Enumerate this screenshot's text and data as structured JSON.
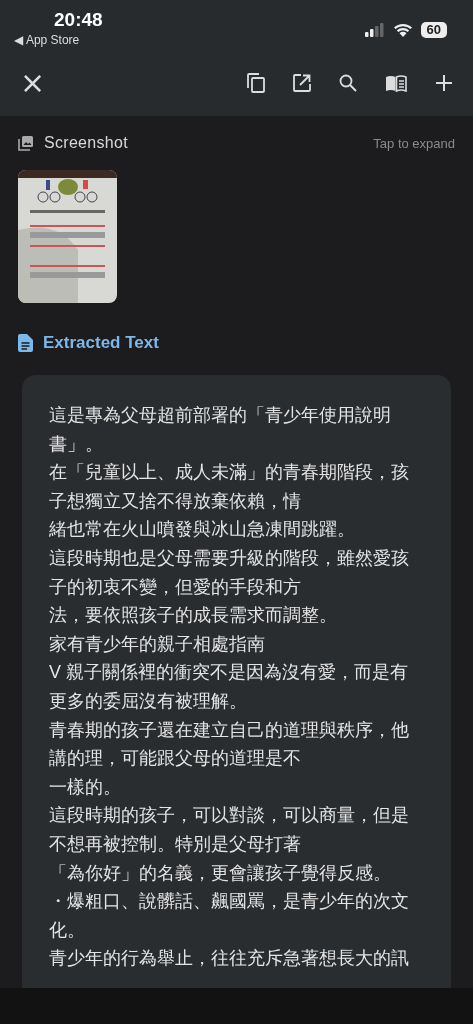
{
  "status_bar": {
    "time": "20:48",
    "back_label": "◀ App Store",
    "battery": "60"
  },
  "toolbar": {
    "close": "×"
  },
  "screenshot_section": {
    "title": "Screenshot",
    "action": "Tap to expand"
  },
  "extracted_section": {
    "title": "Extracted Text",
    "lines": [
      "這是專為父母超前部署的「青少年使用說明",
      "書」。",
      "在「兒童以上、成人未滿」的青春期階段，孩",
      "子想獨立又捨不得放棄依賴，情",
      "緒也常在火山噴發與冰山急凍間跳躍。",
      "這段時期也是父母需要升級的階段，雖然愛孩",
      "子的初衷不變，但愛的手段和方",
      "法，要依照孩子的成長需求而調整。",
      "家有青少年的親子相處指南",
      "V 親子關係裡的衝突不是因為沒有愛，而是有",
      "更多的委屈沒有被理解。",
      "青春期的孩子還在建立自己的道理與秩序，他",
      "講的理，可能跟父母的道理是不",
      "一樣的。",
      "這段時期的孩子，可以對談，可以商量，但是",
      "不想再被控制。特別是父母打著",
      "「為你好」的名義，更會讓孩子覺得反感。",
      "・爆粗口、說髒話、飆國罵，是青少年的次文",
      "化。",
      "青少年的行為舉止，往往充斥急著想長大的訊"
    ]
  }
}
